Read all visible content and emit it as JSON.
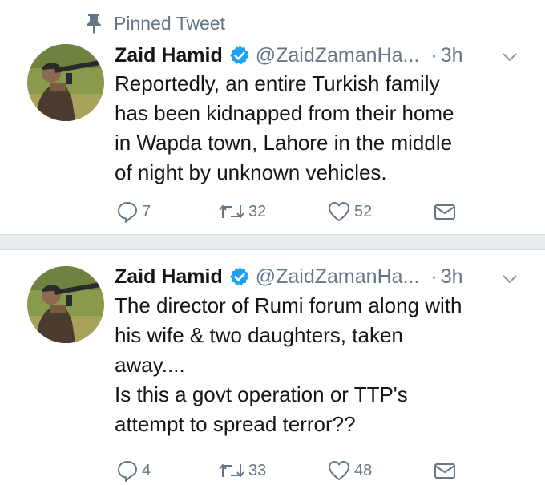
{
  "colors": {
    "text": "#14171a",
    "secondary": "#657786",
    "verified": "#1da1f2",
    "separator": "#e6ecf0"
  },
  "pinned_label": "Pinned Tweet",
  "tweets": [
    {
      "author_name": "Zaid Hamid",
      "handle": "@ZaidZamanHa...",
      "dot": "·",
      "time": "3h",
      "text": "Reportedly, an entire Turkish family\nhas been kidnapped from their home\nin Wapda town, Lahore in the middle\nof night by unknown vehicles.",
      "replies": "7",
      "retweets": "32",
      "likes": "52"
    },
    {
      "author_name": "Zaid Hamid",
      "handle": "@ZaidZamanHa...",
      "dot": "·",
      "time": "3h",
      "text": "The director of Rumi forum along with\nhis wife & two daughters, taken\naway....\nIs this a govt operation or TTP's\nattempt to spread terror??",
      "replies": "4",
      "retweets": "33",
      "likes": "48"
    }
  ],
  "icons": {
    "pin": "pin-icon",
    "verified": "verified-badge-icon",
    "chevron": "chevron-down-icon",
    "reply": "reply-icon",
    "retweet": "retweet-icon",
    "like": "heart-icon",
    "dm": "envelope-icon"
  }
}
